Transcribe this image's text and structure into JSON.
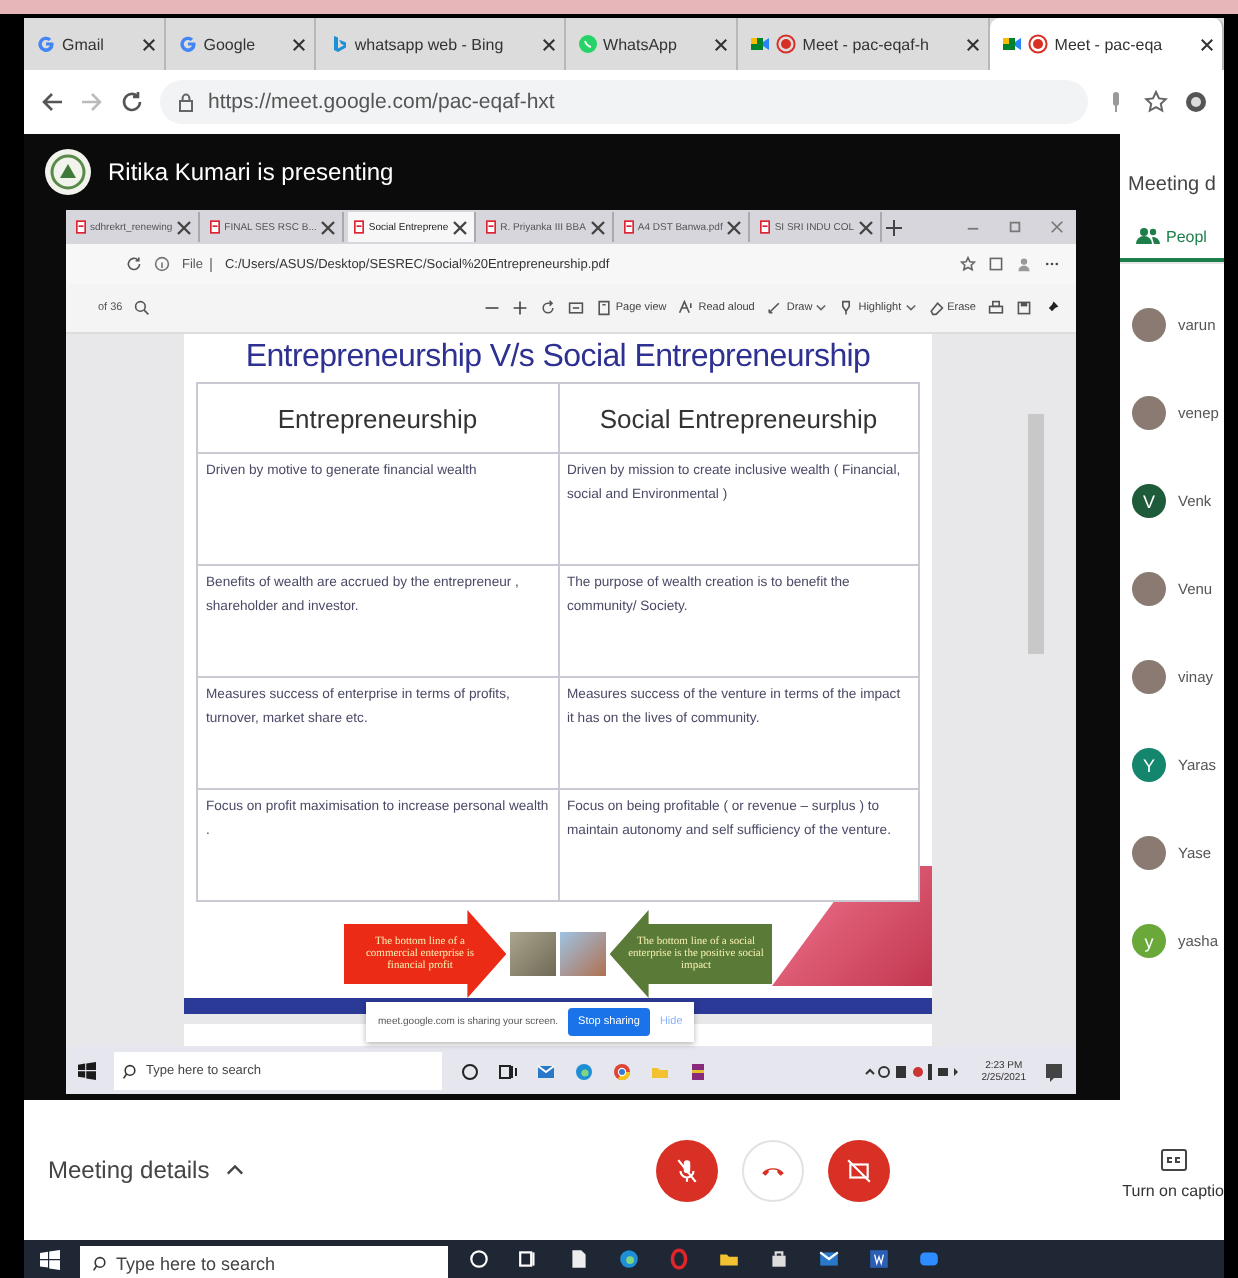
{
  "browser": {
    "tabs": [
      {
        "label": "Gmail",
        "kind": "google",
        "selected": false
      },
      {
        "label": "Google",
        "kind": "google",
        "selected": false
      },
      {
        "label": "whatsapp web - Bing",
        "kind": "bing",
        "selected": false
      },
      {
        "label": "WhatsApp",
        "kind": "whatsapp",
        "selected": false
      },
      {
        "label": "Meet - pac-eqaf-h",
        "kind": "meet",
        "selected": false
      },
      {
        "label": "Meet - pac-eqa",
        "kind": "meet",
        "selected": true
      }
    ],
    "url": "https://meet.google.com/pac-eqaf-hxt"
  },
  "presentation": {
    "title": "Ritika Kumari is presenting"
  },
  "shared_screen": {
    "tabs": [
      {
        "label": "sdhrekrt_renewing",
        "selected": false
      },
      {
        "label": "FINAL SES RSC B...",
        "selected": false
      },
      {
        "label": "Social Entreprene",
        "selected": true
      },
      {
        "label": "R. Priyanka III BBA",
        "selected": false
      },
      {
        "label": "A4 DST Banwa.pdf",
        "selected": false
      },
      {
        "label": "SI SRI INDU COL",
        "selected": false
      }
    ],
    "file_label": "File",
    "path": "C:/Users/ASUS/Desktop/SESREC/Social%20Entrepreneurship.pdf",
    "pdf_toolbar": {
      "page_count": "of 36",
      "items": [
        {
          "label": "Page view",
          "kind": "page",
          "dropdown": false
        },
        {
          "label": "Read aloud",
          "kind": "read",
          "dropdown": false
        },
        {
          "label": "Draw",
          "kind": "draw",
          "dropdown": true
        },
        {
          "label": "Highlight",
          "kind": "highlight",
          "dropdown": true
        },
        {
          "label": "Erase",
          "kind": "erase",
          "dropdown": false
        }
      ]
    },
    "slide": {
      "title": "Entrepreneurship V/s Social Entrepreneurship",
      "columns": [
        "Entrepreneurship",
        "Social Entrepreneurship"
      ],
      "rows": [
        [
          "Driven by motive to generate financial wealth",
          "Driven by mission to create inclusive wealth ( Financial, social and Environmental )"
        ],
        [
          "Benefits of wealth are accrued by the entrepreneur , shareholder and investor.",
          "The purpose of wealth creation is to benefit the community/ Society."
        ],
        [
          "Measures success of enterprise in terms of profits, turnover, market share etc.",
          "Measures success of the venture in terms of the impact it has on the lives of community."
        ],
        [
          "Focus on profit maximisation to increase personal wealth .",
          "Focus on being profitable ( or revenue – surplus ) to maintain autonomy and self sufficiency of the venture."
        ]
      ],
      "arrows": [
        {
          "text": "The bottom line of a commercial enterprise is financial profit",
          "kind": "right"
        },
        {
          "text": "The bottom line of a social enterprise is the positive social impact",
          "kind": "left"
        }
      ]
    },
    "sharing_bar": {
      "message": "meet.google.com is sharing your screen.",
      "stop": "Stop sharing",
      "hide": "Hide"
    },
    "taskbar": {
      "search_placeholder": "Type here to search",
      "time": "2:23 PM",
      "date": "2/25/2021"
    }
  },
  "side_panel": {
    "title": "Meeting d",
    "tabs": [
      {
        "label": "Peopl",
        "selected": true
      }
    ],
    "participants": [
      {
        "name": "varun",
        "kind": "photo"
      },
      {
        "name": "venep",
        "kind": "photo"
      },
      {
        "name": "Venk",
        "kind": "letter",
        "letter": "V",
        "color": "#1e5b3a"
      },
      {
        "name": "Venu",
        "kind": "photo"
      },
      {
        "name": "vinay",
        "kind": "photo"
      },
      {
        "name": "Yaras",
        "kind": "letter",
        "letter": "Y",
        "color": "#14866d"
      },
      {
        "name": "Yase",
        "kind": "photo"
      },
      {
        "name": "yasha",
        "kind": "letter",
        "letter": "y",
        "color": "#6aa83a"
      }
    ]
  },
  "controls": {
    "meeting_details": "Meeting details",
    "buttons": [
      {
        "kind": "mic",
        "on": false
      },
      {
        "kind": "hangup"
      },
      {
        "kind": "camera",
        "on": false
      }
    ],
    "captions": "Turn on captio"
  },
  "taskbar": {
    "search_placeholder": "Type here to search"
  }
}
